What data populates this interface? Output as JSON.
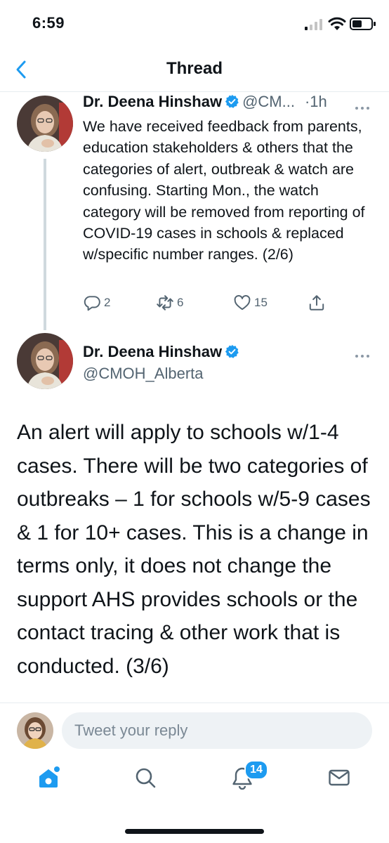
{
  "status": {
    "time": "6:59"
  },
  "nav": {
    "title": "Thread",
    "back_icon": "chevron-left-icon"
  },
  "tweet1": {
    "name": "Dr. Deena Hinshaw",
    "handle": "@CM...",
    "time": "·1h",
    "text": "We have received feedback from parents, education stakeholders & others that the categories of alert, outbreak & watch are confusing. Starting Mon., the watch category will be removed from reporting of COVID-19 cases in schools & replaced w/specific number ranges. (2/6)",
    "replies": "2",
    "retweets": "6",
    "likes": "15"
  },
  "tweet2": {
    "name": "Dr. Deena Hinshaw",
    "handle": "@CMOH_Alberta",
    "text": "An alert will apply to schools w/1-4 cases. There will be two categories of outbreaks – 1 for schools w/5-9 cases & 1 for 10+ cases. This is a change in terms only, it does not change the support AHS provides schools or the contact tracing & other work that is conducted. (3/6)"
  },
  "reply": {
    "placeholder": "Tweet your reply"
  },
  "tabbar": {
    "notification_count": "14",
    "icons": [
      "home-icon",
      "search-icon",
      "notifications-icon",
      "messages-icon"
    ]
  },
  "colors": {
    "accent": "#1d9bf0",
    "secondary_text": "#536471",
    "divider": "#e6ecf0"
  }
}
